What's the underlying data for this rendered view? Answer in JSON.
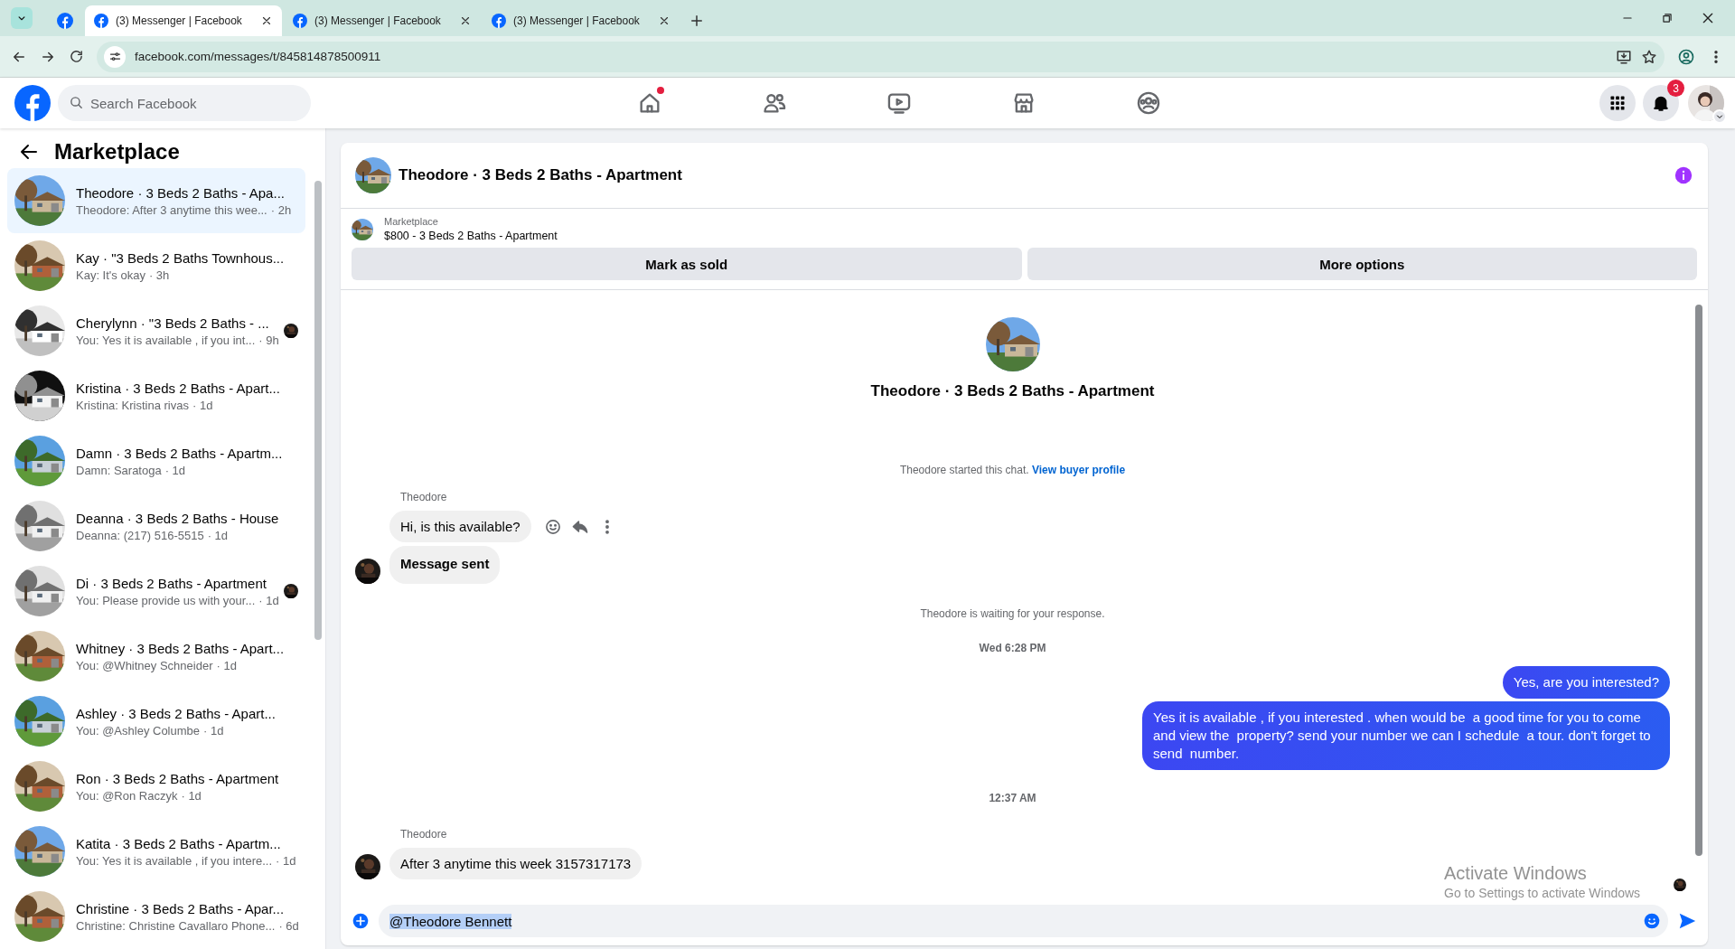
{
  "browser": {
    "tabs": [
      {
        "title": "(3) Messenger | Facebook",
        "selected": true
      },
      {
        "title": "(3) Messenger | Facebook",
        "selected": false
      },
      {
        "title": "(3) Messenger | Facebook",
        "selected": false
      }
    ],
    "url": "facebook.com/messages/t/845814878500911"
  },
  "topbar": {
    "search_placeholder": "Search Facebook",
    "nav": [
      {
        "dot": true
      },
      {
        "dot": false
      },
      {
        "dot": false
      },
      {
        "dot": false
      },
      {
        "dot": false
      }
    ],
    "notification_count": "3"
  },
  "sidebar": {
    "title": "Marketplace",
    "conversations": [
      {
        "title": "Theodore · 3 Beds 2 Baths - Apa...",
        "preview": "Theodore: After 3 anytime this wee...",
        "time": "· 2h",
        "selected": true,
        "seen": false
      },
      {
        "title": "Kay · \"3 Beds 2 Baths Townhous...",
        "preview": "Kay: It's okay",
        "time": "· 3h",
        "selected": false,
        "seen": false
      },
      {
        "title": "Cherylynn · \"3 Beds 2 Baths - ...",
        "preview": "You: Yes it is available , if you int...",
        "time": "· 9h",
        "selected": false,
        "seen": true
      },
      {
        "title": "Kristina · 3 Beds 2 Baths - Apart...",
        "preview": "Kristina: Kristina rivas",
        "time": "· 1d",
        "selected": false,
        "seen": false
      },
      {
        "title": "Damn · 3 Beds 2 Baths - Apartm...",
        "preview": "Damn: Saratoga",
        "time": "· 1d",
        "selected": false,
        "seen": false
      },
      {
        "title": "Deanna · 3 Beds 2 Baths - House",
        "preview": "Deanna: (217) 516-5515",
        "time": "· 1d",
        "selected": false,
        "seen": false
      },
      {
        "title": "Di · 3 Beds 2 Baths - Apartment",
        "preview": "You: Please provide us with your...",
        "time": "· 1d",
        "selected": false,
        "seen": true
      },
      {
        "title": "Whitney · 3 Beds 2 Baths - Apart...",
        "preview": "You: @Whitney Schneider",
        "time": "· 1d",
        "selected": false,
        "seen": false
      },
      {
        "title": "Ashley · 3 Beds 2 Baths - Apart...",
        "preview": "You: @Ashley Columbe",
        "time": "· 1d",
        "selected": false,
        "seen": false
      },
      {
        "title": "Ron · 3 Beds 2 Baths - Apartment",
        "preview": "You: @Ron Raczyk",
        "time": "· 1d",
        "selected": false,
        "seen": false
      },
      {
        "title": "Katita · 3 Beds 2 Baths - Apartm...",
        "preview": "You: Yes it is available , if you intere...",
        "time": "· 1d",
        "selected": false,
        "seen": false
      },
      {
        "title": "Christine · 3 Beds 2 Baths - Apar...",
        "preview": "Christine: Christine Cavallaro Phone...",
        "time": "· 6d",
        "selected": false,
        "seen": false
      }
    ]
  },
  "chat": {
    "title": "Theodore · 3 Beds 2 Baths - Apartment",
    "listing": {
      "label": "Marketplace",
      "price": "$800 - 3 Beds 2 Baths - Apartment",
      "buttons": [
        "Mark as sold",
        "More options"
      ]
    },
    "intro": {
      "title": "Theodore · 3 Beds 2 Baths - Apartment",
      "started": "Theodore started this chat.",
      "link": "View buyer profile"
    },
    "messages": [
      {
        "kind": "sender",
        "text": "Theodore"
      },
      {
        "kind": "incoming",
        "text": "Hi, is this available?",
        "avatar": false,
        "actions": true,
        "emphasis": false
      },
      {
        "kind": "incoming",
        "text": "Message sent",
        "avatar": true,
        "actions": false,
        "emphasis": true
      },
      {
        "kind": "notice",
        "text": "Theodore is waiting for your response."
      },
      {
        "kind": "time",
        "text": "Wed 6:28 PM"
      },
      {
        "kind": "outgoing",
        "text": "Yes, are you interested?"
      },
      {
        "kind": "outgoing",
        "text": "Yes it is available , if you interested . when would be  a good time for you to come and view the  property? send your number we can I schedule  a tour. don't forget to send  number."
      },
      {
        "kind": "time",
        "text": "12:37 AM"
      },
      {
        "kind": "sender",
        "text": "Theodore"
      },
      {
        "kind": "incoming",
        "text": "After 3 anytime this week 3157317173",
        "avatar": true,
        "actions": false,
        "emphasis": false
      }
    ],
    "seen_avatar": true,
    "composer": {
      "value": "@Theodore Bennett",
      "highlighted": true
    }
  },
  "os_notice": {
    "title": "Activate Windows",
    "text": "Go to Settings to activate Windows"
  }
}
